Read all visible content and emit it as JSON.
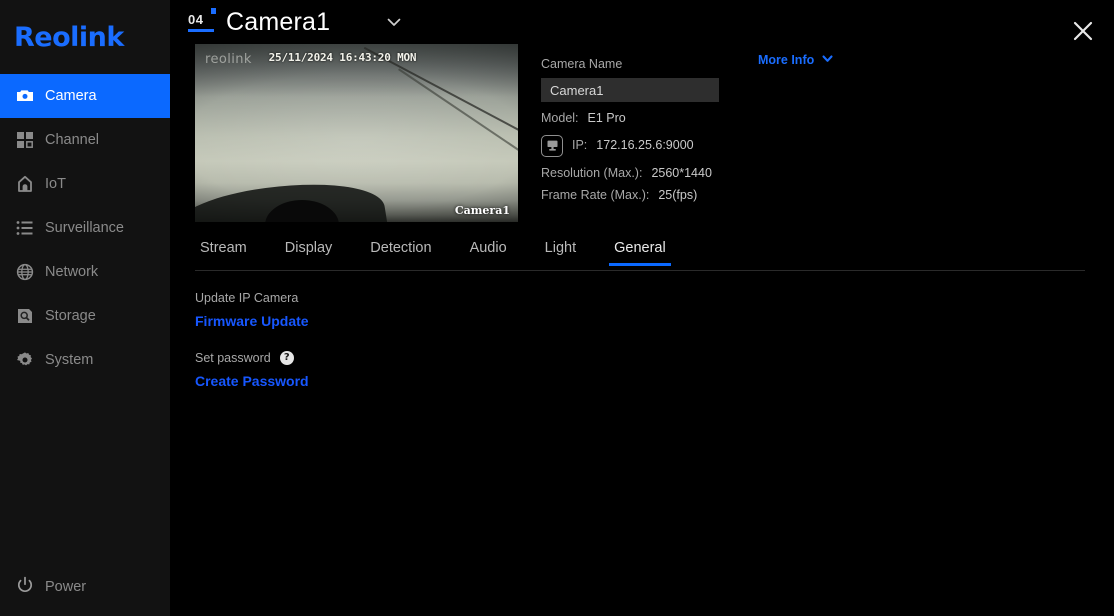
{
  "brand": {
    "name": "Reolink"
  },
  "sidebar": {
    "items": [
      {
        "label": "Camera",
        "icon": "camera-icon",
        "active": true
      },
      {
        "label": "Channel",
        "icon": "grid-icon",
        "active": false
      },
      {
        "label": "IoT",
        "icon": "home-icon",
        "active": false
      },
      {
        "label": "Surveillance",
        "icon": "list-icon",
        "active": false
      },
      {
        "label": "Network",
        "icon": "globe-icon",
        "active": false
      },
      {
        "label": "Storage",
        "icon": "storage-icon",
        "active": false
      },
      {
        "label": "System",
        "icon": "gear-icon",
        "active": false
      }
    ],
    "power": {
      "label": "Power",
      "icon": "power-icon"
    }
  },
  "header": {
    "channel_badge": "04",
    "title": "Camera1",
    "dropdown_icon": "chevron-down-icon",
    "close_icon": "close-icon"
  },
  "preview": {
    "watermark": "reolink",
    "timestamp": "25/11/2024  16:43:20  MON",
    "channel_label": "Camera1"
  },
  "info": {
    "name_label": "Camera Name",
    "name_value": "Camera1",
    "name_placeholder": "Camera Name",
    "more_info_label": "More Info",
    "more_info_icon": "chevron-down-icon",
    "specs": [
      {
        "key": "Model:",
        "value": "E1 Pro"
      },
      {
        "key": "IP:",
        "value": "172.16.25.6:9000",
        "icon": "device-icon"
      },
      {
        "key": "Resolution (Max.):",
        "value": "2560*1440"
      },
      {
        "key": "Frame Rate (Max.):",
        "value": "25(fps)"
      }
    ]
  },
  "tabs": [
    {
      "label": "Stream",
      "active": false
    },
    {
      "label": "Display",
      "active": false
    },
    {
      "label": "Detection",
      "active": false
    },
    {
      "label": "Audio",
      "active": false
    },
    {
      "label": "Light",
      "active": false
    },
    {
      "label": "General",
      "active": true
    }
  ],
  "panel": {
    "update_section_label": "Update IP Camera",
    "firmware_update_link": "Firmware Update",
    "password_section_label": "Set password",
    "password_help_icon": "question-mark-icon",
    "password_help_glyph": "?",
    "create_password_link": "Create Password"
  },
  "colors": {
    "accent_blue": "#1a6dff",
    "active_nav_blue": "#0b69ff",
    "link_blue": "#1757ff",
    "sidebar_bg": "#121212",
    "main_bg": "#000000",
    "input_bg": "#2e2e2e"
  }
}
